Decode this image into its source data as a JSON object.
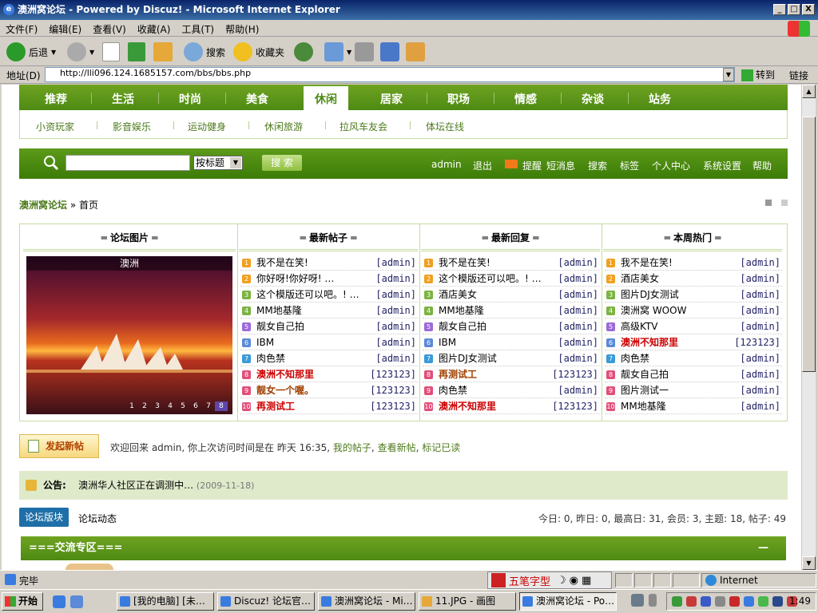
{
  "window": {
    "title": "澳洲窝论坛 - Powered by Discuz! - Microsoft Internet Explorer",
    "min": "_",
    "max": "□",
    "close": "X"
  },
  "menu": [
    "文件(F)",
    "编辑(E)",
    "查看(V)",
    "收藏(A)",
    "工具(T)",
    "帮助(H)"
  ],
  "toolbar": {
    "back": "后退",
    "search": "搜索",
    "favorites": "收藏夹"
  },
  "address": {
    "label": "地址(D)",
    "url": "http://lli096.124.1685157.com/bbs/bbs.php",
    "go": "转到",
    "links": "链接"
  },
  "nav": {
    "items": [
      "推荐",
      "生活",
      "时尚",
      "美食",
      "休闲",
      "居家",
      "职场",
      "情感",
      "杂谈",
      "站务"
    ],
    "active": 4
  },
  "subnav": [
    "小资玩家",
    "影音娱乐",
    "运动健身",
    "休闲旅游",
    "拉风车友会",
    "体坛在线"
  ],
  "search": {
    "select": "按标题",
    "button": "搜 索",
    "user_links": [
      "admin",
      "退出",
      "提醒",
      "短消息",
      "搜索",
      "标签",
      "个人中心",
      "系统设置",
      "帮助"
    ]
  },
  "breadcrumb": {
    "site": "澳洲窝论坛",
    "sep": "»",
    "current": "首页"
  },
  "portal": {
    "headers": [
      "═ 论坛图片 ═",
      "═ 最新帖子 ═",
      "═ 最新回复 ═",
      "═ 本周热门 ═"
    ],
    "pic_title": "澳洲",
    "pic_nums": [
      "1",
      "2",
      "3",
      "4",
      "5",
      "6",
      "7",
      "8"
    ],
    "pic_selected": 7,
    "latest": [
      {
        "t": "我不是在笑!",
        "a": "[admin]",
        "s": ""
      },
      {
        "t": "你好呀!你好呀! …",
        "a": "[admin]",
        "s": ""
      },
      {
        "t": "这个模版还可以吧。! …",
        "a": "[admin]",
        "s": ""
      },
      {
        "t": "MM地基隆",
        "a": "[admin]",
        "s": ""
      },
      {
        "t": "靓女自己拍",
        "a": "[admin]",
        "s": ""
      },
      {
        "t": "IBM",
        "a": "[admin]",
        "s": ""
      },
      {
        "t": "肉色禁",
        "a": "[admin]",
        "s": ""
      },
      {
        "t": "澳洲不知那里",
        "a": "[123123]",
        "s": "red"
      },
      {
        "t": "靓女一个喔。",
        "a": "[123123]",
        "s": "brown"
      },
      {
        "t": "再测试工",
        "a": "[123123]",
        "s": "red"
      }
    ],
    "replies": [
      {
        "t": "我不是在笑!",
        "a": "[admin]",
        "s": ""
      },
      {
        "t": "这个模版还可以吧。! …",
        "a": "[admin]",
        "s": ""
      },
      {
        "t": "酒店美女",
        "a": "[admin]",
        "s": ""
      },
      {
        "t": "MM地基隆",
        "a": "[admin]",
        "s": ""
      },
      {
        "t": "靓女自己拍",
        "a": "[admin]",
        "s": ""
      },
      {
        "t": "IBM",
        "a": "[admin]",
        "s": ""
      },
      {
        "t": "图片DJ女测试",
        "a": "[admin]",
        "s": ""
      },
      {
        "t": "再测试工",
        "a": "[123123]",
        "s": "brown"
      },
      {
        "t": "肉色禁",
        "a": "[admin]",
        "s": ""
      },
      {
        "t": "澳洲不知那里",
        "a": "[123123]",
        "s": "red"
      }
    ],
    "hot": [
      {
        "t": "我不是在笑!",
        "a": "[admin]",
        "s": ""
      },
      {
        "t": "酒店美女",
        "a": "[admin]",
        "s": ""
      },
      {
        "t": "图片DJ女测试",
        "a": "[admin]",
        "s": ""
      },
      {
        "t": "澳洲窝 WOOW",
        "a": "[admin]",
        "s": ""
      },
      {
        "t": "高级KTV",
        "a": "[admin]",
        "s": ""
      },
      {
        "t": "澳洲不知那里",
        "a": "[123123]",
        "s": "red"
      },
      {
        "t": "肉色禁",
        "a": "[admin]",
        "s": ""
      },
      {
        "t": "靓女自己拍",
        "a": "[admin]",
        "s": ""
      },
      {
        "t": "图片测试一",
        "a": "[admin]",
        "s": ""
      },
      {
        "t": "MM地基隆",
        "a": "[admin]",
        "s": ""
      }
    ],
    "badge_nums": [
      "1",
      "2",
      "3",
      "4",
      "5",
      "6",
      "7",
      "8",
      "9",
      "10"
    ],
    "badge_colors": [
      "#f0a020",
      "#f0a020",
      "#7cb342",
      "#7cb342",
      "#9c6ad8",
      "#5b8ad8",
      "#3a9ad8",
      "#e0507a",
      "#e0507a",
      "#e0507a"
    ]
  },
  "newpost": "发起新帖",
  "welcome": {
    "text": "欢迎回来 admin, 你上次访问时间是在 昨天 16:35,",
    "links": [
      "我的帖子",
      "查看新帖",
      "标记已读"
    ]
  },
  "notice": {
    "label": "公告:",
    "text": "澳洲华人社区正在调测中…",
    "date": "(2009-11-18)"
  },
  "tabs": {
    "t1": "论坛版块",
    "t2": "论坛动态"
  },
  "stats": "今日: 0, 昨日: 0, 最高日: 31, 会员: 3, 主题: 18, 帖子: 49",
  "section": {
    "title": "===交流专区===",
    "toggle": "—"
  },
  "status": {
    "text": "完毕",
    "ime": "五笔字型",
    "zone": "Internet"
  },
  "taskbar": {
    "start": "开始",
    "tasks": [
      "[我的电脑] [未…",
      "Discuz! 论坛官…",
      "澳洲窝论坛 - Mi…",
      "11.JPG - 画图",
      "澳洲窝论坛 - Po…"
    ],
    "active": 4,
    "clock": "1:49"
  },
  "colors": {
    "green": "#4d8a13",
    "red": "#c00000",
    "blue": "#1e6fa8"
  }
}
